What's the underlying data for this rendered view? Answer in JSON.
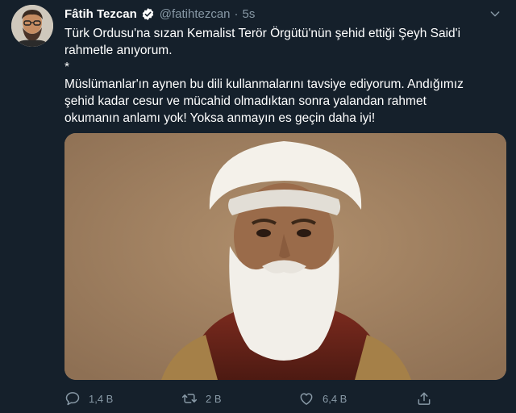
{
  "tweet": {
    "author_name": "Fâtih Tezcan",
    "author_handle": "@fatihtezcan",
    "separator": "·",
    "time": "5s",
    "lines": [
      "Türk Ordusu'na sızan Kemalist Terör Örgütü'nün şehid ettiği Şeyh Said'i",
      "rahmetle anıyorum.",
      "*",
      "Müslümanlar'ın aynen bu dili kullanmalarını tavsiye ediyorum. Andığımız",
      "şehid kadar cesur ve mücahid olmadıktan sonra yalandan rahmet",
      "okumanın anlamı yok! Yoksa anmayın es geçin daha iyi!"
    ]
  },
  "actions": {
    "reply_count": "1,4 B",
    "retweet_count": "2 B",
    "like_count": "6,4 B"
  },
  "icons": {
    "verified": "verified-badge-icon",
    "more": "chevron-down-icon",
    "reply": "reply-icon",
    "retweet": "retweet-icon",
    "like": "heart-icon",
    "share": "share-icon"
  },
  "colors": {
    "background": "#15202b",
    "secondary_text": "#8899a6",
    "verified": "#ffffff"
  }
}
